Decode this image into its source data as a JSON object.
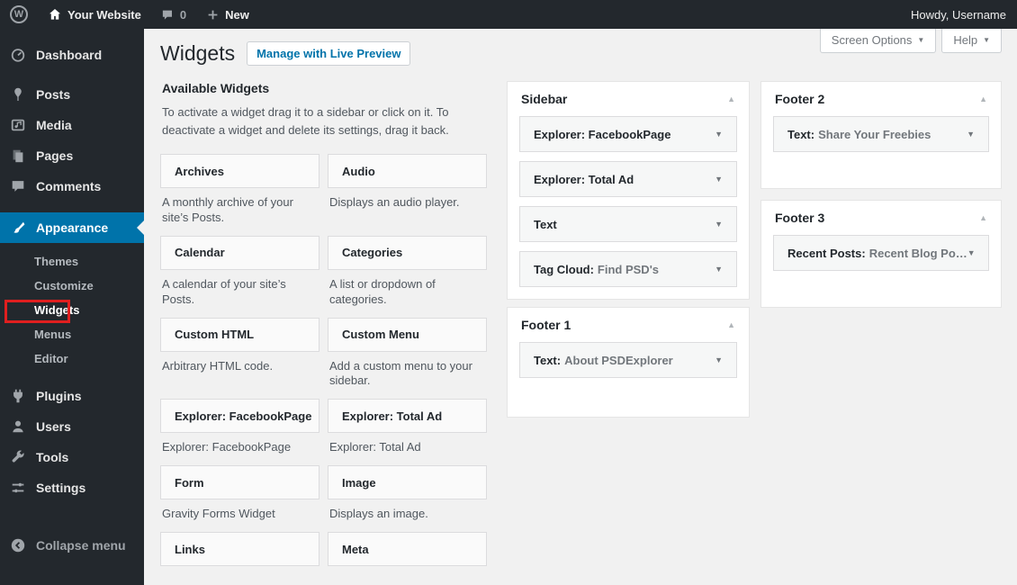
{
  "admin_bar": {
    "logo_glyph": "W",
    "site_name": "Your Website",
    "comments_count": "0",
    "new_label": "New",
    "howdy": "Howdy, Username"
  },
  "toolbar": {
    "screen_options": "Screen Options",
    "help": "Help"
  },
  "page": {
    "title": "Widgets",
    "manage_button": "Manage with Live Preview"
  },
  "menu": {
    "items": [
      {
        "label": "Dashboard"
      },
      {
        "label": "Posts"
      },
      {
        "label": "Media"
      },
      {
        "label": "Pages"
      },
      {
        "label": "Comments"
      },
      {
        "label": "Appearance"
      },
      {
        "label": "Plugins"
      },
      {
        "label": "Users"
      },
      {
        "label": "Tools"
      },
      {
        "label": "Settings"
      }
    ],
    "appearance_submenu": [
      {
        "label": "Themes"
      },
      {
        "label": "Customize"
      },
      {
        "label": "Widgets"
      },
      {
        "label": "Menus"
      },
      {
        "label": "Editor"
      }
    ],
    "collapse": "Collapse menu"
  },
  "available": {
    "title": "Available Widgets",
    "description": "To activate a widget drag it to a sidebar or click on it. To deactivate a widget and delete its settings, drag it back.",
    "widgets": [
      {
        "name": "Archives",
        "desc": "A monthly archive of your site’s Posts."
      },
      {
        "name": "Audio",
        "desc": "Displays an audio player."
      },
      {
        "name": "Calendar",
        "desc": "A calendar of your site’s Posts."
      },
      {
        "name": "Categories",
        "desc": "A list or dropdown of categories."
      },
      {
        "name": "Custom HTML",
        "desc": "Arbitrary HTML code."
      },
      {
        "name": "Custom Menu",
        "desc": "Add a custom menu to your sidebar."
      },
      {
        "name": "Explorer: FacebookPage",
        "desc": "Explorer: FacebookPage"
      },
      {
        "name": "Explorer: Total Ad",
        "desc": "Explorer: Total Ad"
      },
      {
        "name": "Form",
        "desc": "Gravity Forms Widget"
      },
      {
        "name": "Image",
        "desc": "Displays an image."
      },
      {
        "name": "Links",
        "desc": ""
      },
      {
        "name": "Meta",
        "desc": ""
      }
    ]
  },
  "areas": [
    {
      "title": "Sidebar",
      "items": [
        {
          "name": "Explorer: FacebookPage",
          "detail": ""
        },
        {
          "name": "Explorer: Total Ad",
          "detail": ""
        },
        {
          "name": "Text",
          "detail": ""
        },
        {
          "name": "Tag Cloud:",
          "detail": "Find PSD's"
        }
      ]
    },
    {
      "title": "Footer 1",
      "items": [
        {
          "name": "Text:",
          "detail": "About PSDExplorer"
        }
      ]
    },
    {
      "title": "Footer 2",
      "items": [
        {
          "name": "Text:",
          "detail": "Share Your Freebies"
        }
      ]
    },
    {
      "title": "Footer 3",
      "items": [
        {
          "name": "Recent Posts:",
          "detail": "Recent Blog Po…"
        }
      ]
    }
  ],
  "icons": {
    "chevron_down": "▼",
    "chevron_up": "▲"
  },
  "colors": {
    "accent_blue": "#0073aa",
    "admin_dark": "#23282d",
    "annotation_red": "#e01f1f",
    "content_bg": "#f1f1f1"
  }
}
